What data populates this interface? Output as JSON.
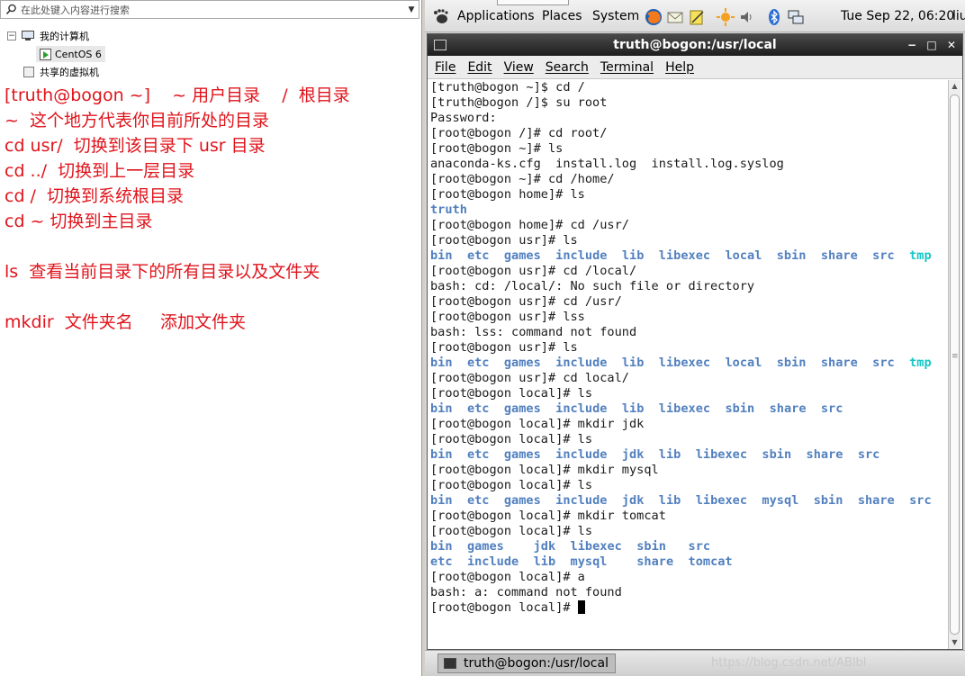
{
  "host": {
    "search_placeholder": "在此处键入内容进行搜索",
    "tree": {
      "my_computer": "我的计算机",
      "vm": "CentOS 6",
      "shared": "共享的虚拟机"
    }
  },
  "notes": [
    "[truth@bogon ~]    ~ 用户目录    /  根目录",
    "~  这个地方代表你目前所处的目录",
    "cd usr/  切换到该目录下 usr 目录",
    "cd ../  切换到上一层目录",
    "cd /  切换到系统根目录",
    "cd ~ 切换到主目录",
    "ls  查看当前目录下的所有目录以及文件夹",
    "mkdir  文件夹名     添加文件夹"
  ],
  "guest_panel": {
    "applications": "Applications",
    "places": "Places",
    "system": "System",
    "clock": "Tue Sep 22, 06:20",
    "user": "liu",
    "icons": [
      "firefox-icon",
      "mail-icon",
      "notes-icon",
      "sun-update-icon",
      "volume-icon",
      "bluetooth-icon",
      "network-icon"
    ]
  },
  "terminal": {
    "title": "truth@bogon:/usr/local",
    "window_controls": [
      "−",
      "□",
      "✕"
    ],
    "menu": [
      "File",
      "Edit",
      "View",
      "Search",
      "Terminal",
      "Help"
    ],
    "lines": [
      "[truth@bogon ~]$ cd /",
      "[truth@bogon /]$ su root",
      "Password:",
      "[root@bogon /]# cd root/",
      "[root@bogon ~]# ls",
      "anaconda-ks.cfg  install.log  install.log.syslog",
      "[root@bogon ~]# cd /home/",
      "[root@bogon home]# ls",
      "truth",
      "[root@bogon home]# cd /usr/",
      "[root@bogon usr]# ls",
      "bin  etc  games  include  lib  libexec  local  sbin  share  src  tmp",
      "[root@bogon usr]# cd /local/",
      "bash: cd: /local/: No such file or directory",
      "[root@bogon usr]# cd /usr/",
      "[root@bogon usr]# lss",
      "bash: lss: command not found",
      "[root@bogon usr]# ls",
      "bin  etc  games  include  lib  libexec  local  sbin  share  src  tmp",
      "[root@bogon usr]# cd local/",
      "[root@bogon local]# ls",
      "bin  etc  games  include  lib  libexec  sbin  share  src",
      "[root@bogon local]# mkdir jdk",
      "[root@bogon local]# ls",
      "bin  etc  games  include  jdk  lib  libexec  sbin  share  src",
      "[root@bogon local]# mkdir mysql",
      "[root@bogon local]# ls",
      "bin  etc  games  include  jdk  lib  libexec  mysql  sbin  share  src",
      "[root@bogon local]# mkdir tomcat",
      "[root@bogon local]# ls",
      "bin  games    jdk  libexec  sbin   src",
      "etc  include  lib  mysql    share  tomcat",
      "[root@bogon local]# a",
      "bash: a: command not found",
      "[root@bogon local]# "
    ],
    "dir_line_indices": [
      8,
      11,
      18,
      21,
      24,
      27,
      30,
      31
    ],
    "cyan_word": "tmp",
    "colors": {
      "dir": "#5280bf",
      "cyan": "#16c7c7",
      "text": "#1a1a1a"
    }
  },
  "taskbar": {
    "window_button": "truth@bogon:/usr/local",
    "watermark": "https://blog.csdn.net/ABlbl"
  }
}
